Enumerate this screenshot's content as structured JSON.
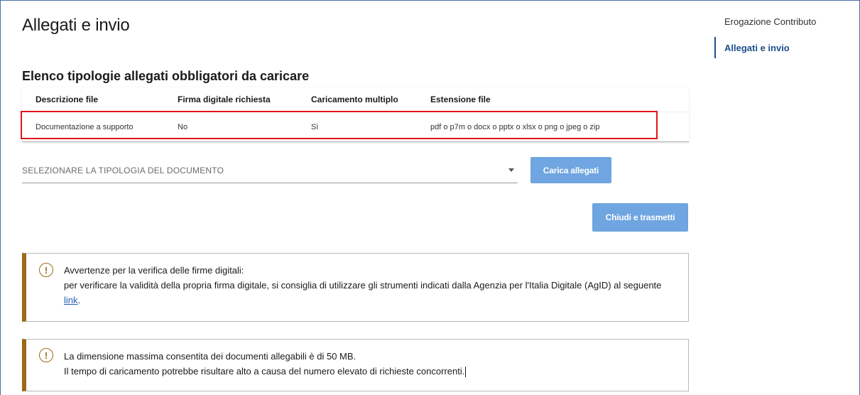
{
  "page": {
    "title": "Allegati e invio",
    "section_title": "Elenco tipologie allegati obbligatori da caricare"
  },
  "table": {
    "headers": [
      "Descrizione file",
      "Firma digitale richiesta",
      "Caricamento multiplo",
      "Estensione file"
    ],
    "rows": [
      [
        "Documentazione a supporto",
        "No",
        "Sì",
        "pdf o p7m o docx o pptx o xlsx o png o jpeg o zip"
      ]
    ]
  },
  "form": {
    "select_placeholder": "SELEZIONARE LA TIPOLOGIA DEL DOCUMENTO",
    "upload_label": "Carica allegati",
    "submit_label": "Chiudi e trasmetti"
  },
  "notices": [
    {
      "title": "Avvertenze per la verifica delle firme digitali:",
      "body": "per verificare la validità della propria firma digitale, si consiglia di utilizzare gli strumenti indicati dalla Agenzia per l'Italia Digitale (AgID) al seguente ",
      "link": "link",
      "suffix": ".",
      "icon": "warning-icon"
    },
    {
      "line1": "La dimensione massima consentita dei documenti allegabili è di 50 MB.",
      "line2": "Il tempo di caricamento potrebbe risultare alto a causa del numero elevato di richieste concorrenti.",
      "icon": "warning-icon"
    }
  ],
  "sidenav": {
    "items": [
      {
        "label": "Erogazione Contributo",
        "active": false
      },
      {
        "label": "Allegati e invio",
        "active": true
      }
    ]
  },
  "colors": {
    "primary_button": "#6fa5e0",
    "notice_accent": "#9c6a14",
    "highlight_border": "#e3141b",
    "nav_active": "#1f4e8c"
  }
}
